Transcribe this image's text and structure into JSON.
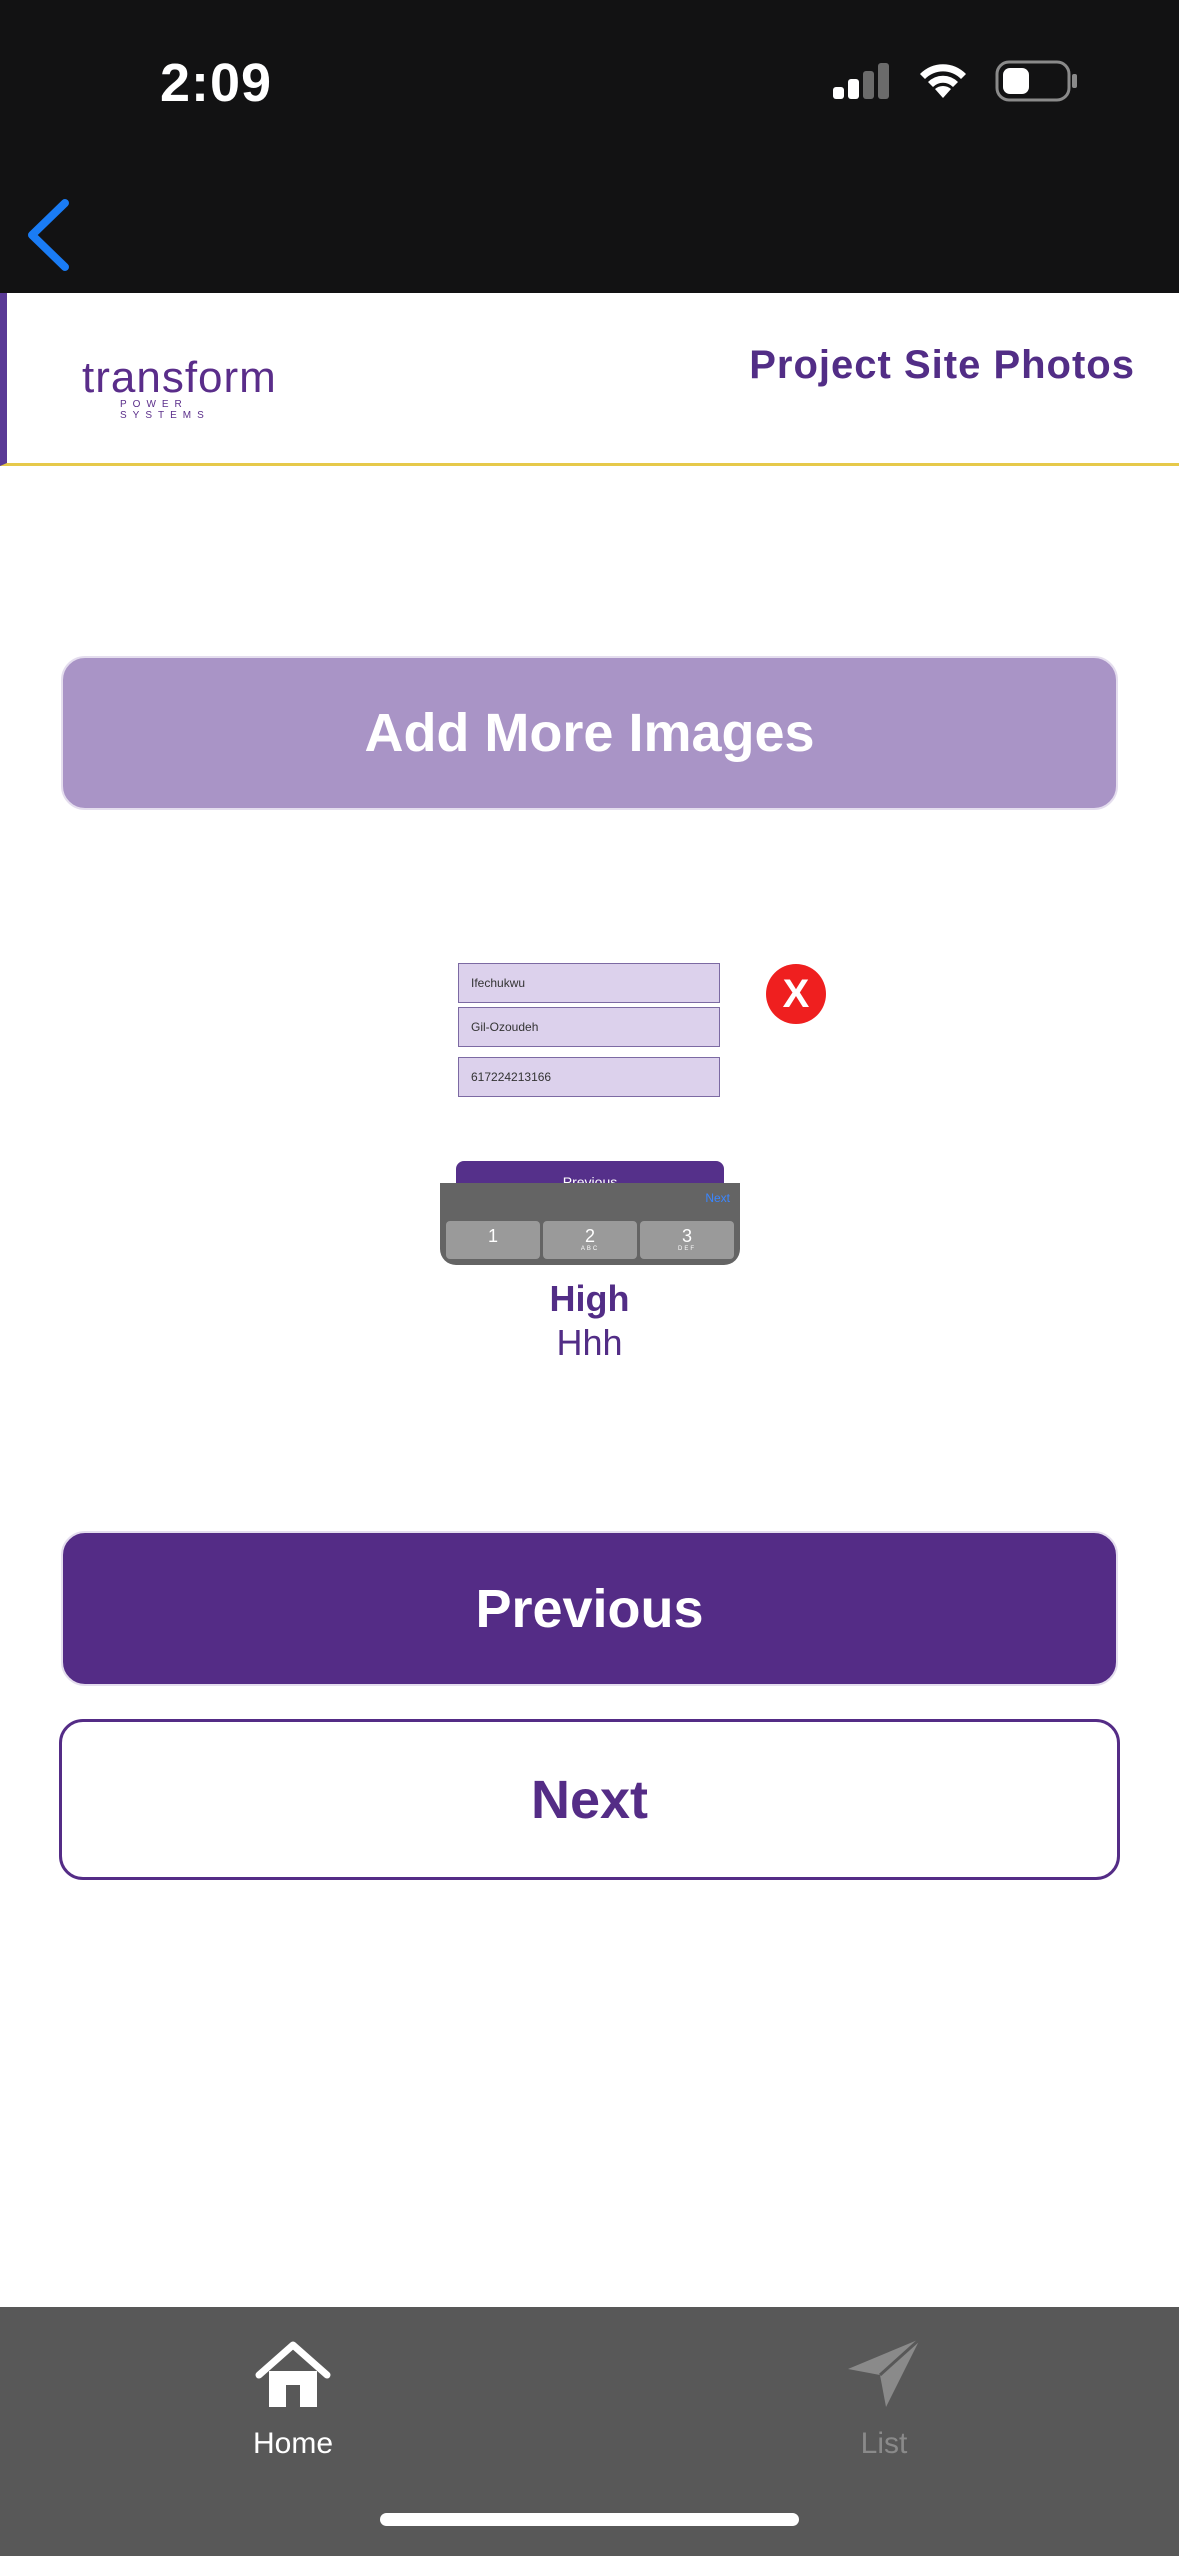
{
  "status_bar": {
    "time": "2:09"
  },
  "header": {
    "logo_text": "transform",
    "logo_subtitle": "POWER SYSTEMS",
    "title": "Project Site Photos"
  },
  "main": {
    "add_images_label": "Add More Images",
    "image": {
      "thumbnail_fields": [
        "Ifechukwu",
        "Gil-Ozoudeh",
        "617224213166"
      ],
      "thumbnail_button": "Previous",
      "thumbnail_keyboard_next": "Next",
      "thumbnail_keys": [
        {
          "num": "1",
          "letters": ""
        },
        {
          "num": "2",
          "letters": "ABC"
        },
        {
          "num": "3",
          "letters": "DEF"
        }
      ],
      "remove_label": "X",
      "title": "High",
      "description": "Hhh"
    },
    "previous_label": "Previous",
    "next_label": "Next"
  },
  "tab_bar": {
    "items": [
      {
        "label": "Home",
        "icon": "home-icon",
        "active": true
      },
      {
        "label": "List",
        "icon": "send-icon",
        "active": false
      }
    ]
  },
  "colors": {
    "brand_purple": "#542c86",
    "light_purple": "#a994c6",
    "remove_red": "#ef1f1f",
    "accent_yellow": "#e6c94a",
    "ios_blue": "#1a7cf5"
  }
}
